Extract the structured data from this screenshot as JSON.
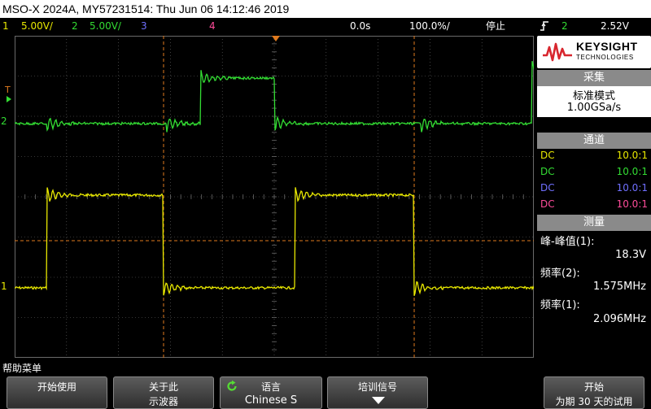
{
  "title": "MSO-X 2024A, MY57231514: Thu Jun 06 14:12:46 2019",
  "status": {
    "ch1_num": "1",
    "ch1_scale": "5.00V/",
    "ch2_num": "2",
    "ch2_scale": "5.00V/",
    "ch3_num": "3",
    "ch4_num": "4",
    "time_delay": "0.0s",
    "time_scale": "100.0%/",
    "run_state": "停止",
    "trigger_icon": "trigger-rising-edge-icon",
    "trigger_src": "2",
    "trigger_level": "2.52V"
  },
  "colors": {
    "ch1": "#e8e800",
    "ch2": "#33dd33",
    "ch3": "#7070ff",
    "ch4": "#ff4c9a",
    "cursor": "#e07a1e",
    "grid": "#6a6a6a",
    "panel_header": "#8a8a8a"
  },
  "screen": {
    "ch1_marker": "1",
    "ch2_marker": "2",
    "trigger_marker": "T"
  },
  "right_panel": {
    "logo_name": "KEYSIGHT",
    "logo_sub": "TECHNOLOGIES",
    "acq_header": "采集",
    "acq_mode": "标准模式",
    "acq_rate": "1.00GSa/s",
    "channels_header": "通道",
    "channels": [
      {
        "coupling": "DC",
        "probe": "10.0:1"
      },
      {
        "coupling": "DC",
        "probe": "10.0:1"
      },
      {
        "coupling": "DC",
        "probe": "10.0:1"
      },
      {
        "coupling": "DC",
        "probe": "10.0:1"
      }
    ],
    "meas_header": "测量",
    "measurements": [
      {
        "label": "峰-峰值(1):",
        "value": "18.3V"
      },
      {
        "label": "频率(2):",
        "value": "1.575MHz"
      },
      {
        "label": "频率(1):",
        "value": "2.096MHz"
      }
    ]
  },
  "help_label": "帮助菜单",
  "softkeys": {
    "start_use": "开始使用",
    "about_1": "关于此",
    "about_2": "示波器",
    "lang_1": "语言",
    "lang_2": "Chinese S",
    "training_1": "培训信号",
    "trial_1": "开始",
    "trial_2": "为期 30 天的试用"
  }
}
